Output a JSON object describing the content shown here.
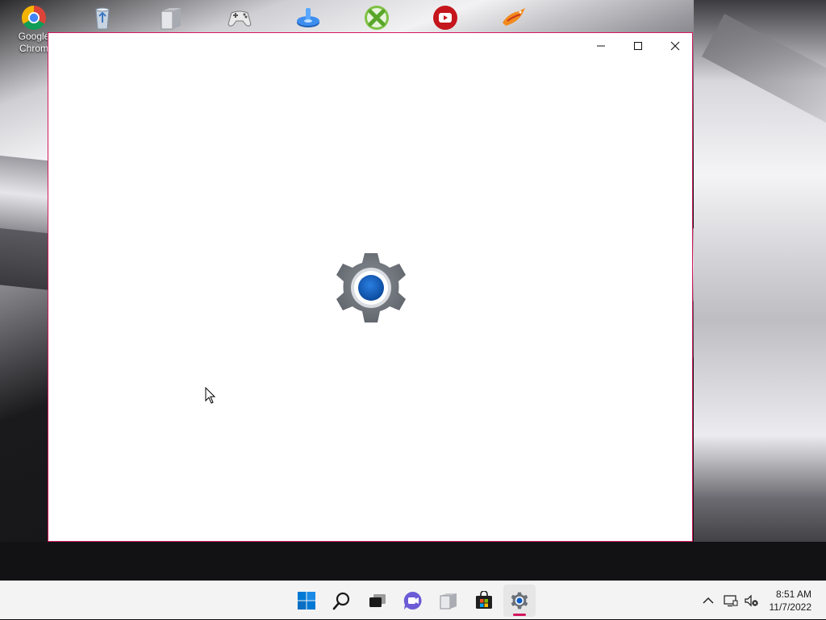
{
  "desktop": {
    "icons": [
      {
        "name": "Google Chrome",
        "label": "Google\nChrom"
      },
      {
        "name": "Recycle Bin",
        "label": ""
      },
      {
        "name": "File Explorer",
        "label": ""
      },
      {
        "name": "Game Controller",
        "label": ""
      },
      {
        "name": "Blue Disc App",
        "label": ""
      },
      {
        "name": "Xbox",
        "label": ""
      },
      {
        "name": "YouTube",
        "label": ""
      },
      {
        "name": "Bird App",
        "label": ""
      }
    ]
  },
  "window": {
    "app": "Settings",
    "state": "loading-splash",
    "accent_color": "#d3165e",
    "splash_icon": "gear-icon",
    "controls": [
      "minimize",
      "maximize",
      "close"
    ]
  },
  "taskbar": {
    "items": [
      {
        "name": "Start",
        "icon": "windows-start-icon"
      },
      {
        "name": "Search",
        "icon": "search-icon"
      },
      {
        "name": "Task View",
        "icon": "task-view-icon"
      },
      {
        "name": "Chat",
        "icon": "chat-icon"
      },
      {
        "name": "File Explorer",
        "icon": "folder-icon"
      },
      {
        "name": "Microsoft Store",
        "icon": "store-icon"
      },
      {
        "name": "Settings",
        "icon": "gear-icon",
        "active": true
      }
    ],
    "tray": {
      "time": "8:51 AM",
      "date": "11/7/2022"
    }
  }
}
